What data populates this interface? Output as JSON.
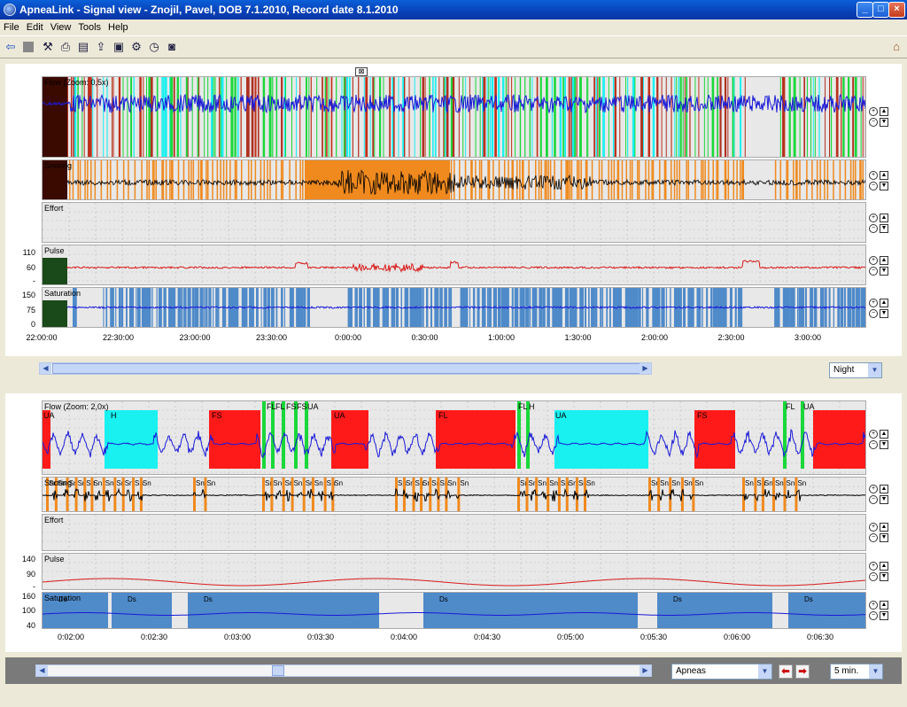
{
  "window": {
    "title": "ApneaLink - Signal view - Znojil, Pavel, DOB 7.1.2010, Record date 8.1.2010",
    "min": "_",
    "max": "□",
    "close": "×"
  },
  "menu": [
    "File",
    "Edit",
    "View",
    "Tools",
    "Help"
  ],
  "toolbar": {
    "back_icon": "back-arrow-icon",
    "home_icon": "home-icon"
  },
  "overview": {
    "tracks": {
      "flow": "Flow (Zoom: 0,5x)",
      "snoring": "Snoring",
      "effort": "Effort",
      "pulse": "Pulse",
      "saturation": "Saturation"
    },
    "pulse_ticks": [
      "110",
      "60",
      "-"
    ],
    "sat_ticks": [
      "150",
      "75",
      "0"
    ],
    "time_axis": [
      "22:00:00",
      "22:30:00",
      "23:00:00",
      "23:30:00",
      "0:00:00",
      "0:30:00",
      "1:00:00",
      "1:30:00",
      "2:00:00",
      "2:30:00",
      "3:00:00"
    ],
    "range_select": "Night"
  },
  "detail": {
    "tracks": {
      "flow": "Flow (Zoom: 2,0x)",
      "snoring": "Snoring",
      "effort": "Effort",
      "pulse": "Pulse",
      "saturation": "Saturation"
    },
    "pulse_ticks": [
      "140",
      "90",
      "-"
    ],
    "sat_ticks": [
      "160",
      "100",
      "40"
    ],
    "time_axis": [
      "0:02:00",
      "0:02:30",
      "0:03:00",
      "0:03:30",
      "0:04:00",
      "0:04:30",
      "0:05:00",
      "0:05:30",
      "0:06:00",
      "0:06:30"
    ],
    "events": [
      "UA",
      "H",
      "FS",
      "FL",
      "FL",
      "FS",
      "FS",
      "UA",
      "UA",
      "FL",
      "FL",
      "H",
      "UA",
      "FS",
      "FL",
      "UA"
    ],
    "desat_label": "Ds",
    "snore_label": "Sn",
    "event_select": "Apneas",
    "window_select": "5 min."
  },
  "colors": {
    "flow": "#1a1ad8",
    "pulse": "#d81a1a",
    "sat_bar": "#4f8ac9",
    "sat_line": "#1a1ad8",
    "ua": "#ff1a1a",
    "hypopnea": "#19f0f0",
    "flatten": "#19d83a",
    "snore": "#f08a1e"
  }
}
